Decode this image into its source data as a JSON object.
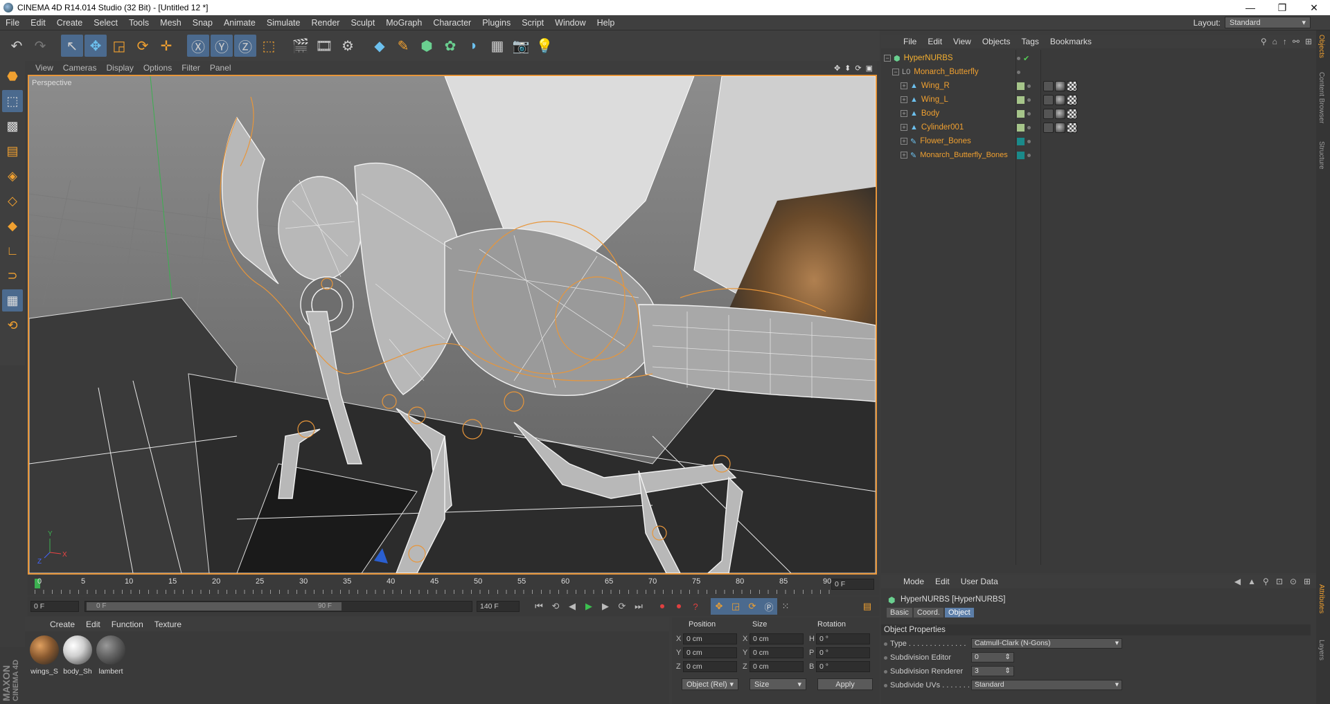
{
  "window": {
    "title": "CINEMA 4D R14.014 Studio (32 Bit) - [Untitled 12 *]",
    "minimize": "—",
    "maximize": "❐",
    "close": "✕"
  },
  "menubar": {
    "items": [
      "File",
      "Edit",
      "Create",
      "Select",
      "Tools",
      "Mesh",
      "Snap",
      "Animate",
      "Simulate",
      "Render",
      "Sculpt",
      "MoGraph",
      "Character",
      "Plugins",
      "Script",
      "Window",
      "Help"
    ],
    "layout_label": "Layout:",
    "layout_value": "Standard"
  },
  "viewport": {
    "menu": [
      "View",
      "Cameras",
      "Display",
      "Options",
      "Filter",
      "Panel"
    ],
    "label": "Perspective",
    "axis_x": "X",
    "axis_y": "Y",
    "axis_z": "Z"
  },
  "object_manager": {
    "menu": [
      "File",
      "Edit",
      "View",
      "Objects",
      "Tags",
      "Bookmarks"
    ],
    "objects": [
      {
        "name": "HyperNURBS",
        "level": 0,
        "icon": "hypernurbs-icon",
        "color": "#f5b030"
      },
      {
        "name": "Monarch_Butterfly",
        "level": 1,
        "icon": "null-icon",
        "color": "#f0a030"
      },
      {
        "name": "Wing_R",
        "level": 2,
        "icon": "polygon-icon",
        "color": "#f0a030"
      },
      {
        "name": "Wing_L",
        "level": 2,
        "icon": "polygon-icon",
        "color": "#f0a030"
      },
      {
        "name": "Body",
        "level": 2,
        "icon": "polygon-icon",
        "color": "#f0a030"
      },
      {
        "name": "Cylinder001",
        "level": 2,
        "icon": "polygon-icon",
        "color": "#f0a030"
      },
      {
        "name": "Flower_Bones",
        "level": 2,
        "icon": "bone-icon",
        "color": "#f0a030"
      },
      {
        "name": "Monarch_Butterfly_Bones",
        "level": 2,
        "icon": "bone-icon",
        "color": "#f0a030"
      }
    ],
    "side_tabs": [
      "Objects",
      "Content Browser",
      "Structure"
    ]
  },
  "timeline": {
    "ticks": [
      "0",
      "5",
      "10",
      "15",
      "20",
      "25",
      "30",
      "35",
      "40",
      "45",
      "50",
      "55",
      "60",
      "65",
      "70",
      "75",
      "80",
      "85",
      "90"
    ],
    "current_frame": "0 F",
    "start_field": "0 F",
    "range_start": "0 F",
    "range_end": "90 F",
    "end_field": "140 F"
  },
  "materials": {
    "menu": [
      "Create",
      "Edit",
      "Function",
      "Texture"
    ],
    "items": [
      {
        "name": "wings_S",
        "color": "#8a5a30"
      },
      {
        "name": "body_Sh",
        "color": "#cfcfcf"
      },
      {
        "name": "lambert",
        "color": "#666666"
      }
    ],
    "brand_line1": "MAXON",
    "brand_line2": "CINEMA 4D"
  },
  "coordinates": {
    "headers": [
      "Position",
      "Size",
      "Rotation"
    ],
    "rows": [
      {
        "axis": "X",
        "pos": "0 cm",
        "size_axis": "X",
        "size": "0 cm",
        "rot_axis": "H",
        "rot": "0 °"
      },
      {
        "axis": "Y",
        "pos": "0 cm",
        "size_axis": "Y",
        "size": "0 cm",
        "rot_axis": "P",
        "rot": "0 °"
      },
      {
        "axis": "Z",
        "pos": "0 cm",
        "size_axis": "Z",
        "size": "0 cm",
        "rot_axis": "B",
        "rot": "0 °"
      }
    ],
    "mode_dropdown": "Object (Rel)",
    "size_dropdown": "Size",
    "apply": "Apply"
  },
  "attributes": {
    "menu": [
      "Mode",
      "Edit",
      "User Data"
    ],
    "title": "HyperNURBS [HyperNURBS]",
    "tabs": [
      "Basic",
      "Coord.",
      "Object"
    ],
    "active_tab": "Object",
    "section": "Object Properties",
    "props": [
      {
        "label": "Type . . . . . . . . . . . . . .",
        "value": "Catmull-Clark (N-Gons)",
        "kind": "dropdown"
      },
      {
        "label": "Subdivision Editor",
        "value": "0",
        "kind": "number"
      },
      {
        "label": "Subdivision Renderer",
        "value": "3",
        "kind": "number"
      },
      {
        "label": "Subdivide UVs . . . . . . .",
        "value": "Standard",
        "kind": "dropdown"
      }
    ],
    "side_tabs": [
      "Attributes",
      "Layers"
    ]
  },
  "colors": {
    "accent": "#f0a030",
    "selection": "#4b6a8e",
    "tab_active": "#5c7ea8"
  }
}
